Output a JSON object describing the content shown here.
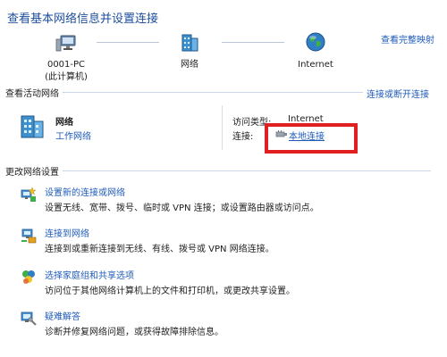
{
  "header": {
    "title": "查看基本网络信息并设置连接",
    "full_map_link": "查看完整映射"
  },
  "network_map": {
    "nodes": [
      {
        "label_line1": "0001-PC",
        "label_line2": "(此计算机)",
        "icon": "computer-icon"
      },
      {
        "label_line1": "网络",
        "label_line2": "",
        "icon": "network-building-icon"
      },
      {
        "label_line1": "Internet",
        "label_line2": "",
        "icon": "globe-icon"
      }
    ]
  },
  "active_networks": {
    "section_title": "查看活动网络",
    "connect_disconnect_link": "连接或断开连接",
    "network_name": "网络",
    "network_type_link": "工作网络",
    "access_type_label": "访问类型:",
    "access_type_value": "Internet",
    "connection_label": "连接:",
    "connection_link": "本地连接"
  },
  "change_settings": {
    "section_title": "更改网络设置",
    "items": [
      {
        "title": "设置新的连接或网络",
        "desc": "设置无线、宽带、拨号、临时或 VPN 连接；或设置路由器或访问点。",
        "icon": "new-connection-icon"
      },
      {
        "title": "连接到网络",
        "desc": "连接到或重新连接到无线、有线、拨号或 VPN 网络连接。",
        "icon": "connect-network-icon"
      },
      {
        "title": "选择家庭组和共享选项",
        "desc": "访问位于其他网络计算机上的文件和打印机，或更改共享设置。",
        "icon": "homegroup-icon"
      },
      {
        "title": "疑难解答",
        "desc": "诊断并修复网络问题，或获得故障排除信息。",
        "icon": "troubleshoot-icon"
      }
    ]
  },
  "colors": {
    "link": "#1e5bb8",
    "highlight_box": "#e02020"
  }
}
